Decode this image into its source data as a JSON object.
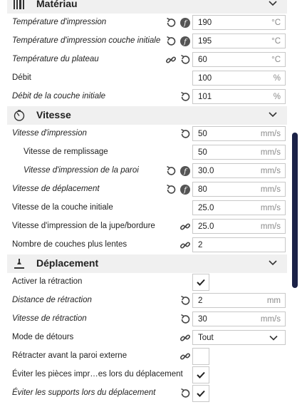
{
  "materiau": {
    "title": "Matériau",
    "rows": [
      {
        "label": "Température d'impression",
        "value": "190",
        "unit": "°C"
      },
      {
        "label": "Température d'impression couche initiale",
        "value": "195",
        "unit": "°C"
      },
      {
        "label": "Température du plateau",
        "value": "60",
        "unit": "°C"
      },
      {
        "label": "Débit",
        "value": "100",
        "unit": "%"
      },
      {
        "label": "Débit de la couche initiale",
        "value": "101",
        "unit": "%"
      }
    ]
  },
  "vitesse": {
    "title": "Vitesse",
    "rows": [
      {
        "label": "Vitesse d'impression",
        "value": "50",
        "unit": "mm/s"
      },
      {
        "label": "Vitesse de remplissage",
        "value": "50",
        "unit": "mm/s"
      },
      {
        "label": "Vitesse d'impression de la paroi",
        "value": "30.0",
        "unit": "mm/s"
      },
      {
        "label": "Vitesse de déplacement",
        "value": "80",
        "unit": "mm/s"
      },
      {
        "label": "Vitesse de la couche initiale",
        "value": "25.0",
        "unit": "mm/s"
      },
      {
        "label": "Vitesse d'impression de la jupe/bordure",
        "value": "25.0",
        "unit": "mm/s"
      },
      {
        "label": "Nombre de couches plus lentes",
        "value": "2",
        "unit": ""
      }
    ]
  },
  "deplacement": {
    "title": "Déplacement",
    "rows": [
      {
        "label": "Activer la rétraction"
      },
      {
        "label": "Distance de rétraction",
        "value": "2",
        "unit": "mm"
      },
      {
        "label": "Vitesse de rétraction",
        "value": "30",
        "unit": "mm/s"
      },
      {
        "label": "Mode de détours",
        "value": "Tout"
      },
      {
        "label": "Rétracter avant la paroi externe"
      },
      {
        "label": "Éviter les pièces impr…es lors du déplacement"
      },
      {
        "label": "Éviter les supports lors du déplacement"
      }
    ]
  },
  "icons": {
    "reset": "reset-icon",
    "function": "function-icon",
    "link": "link-icon",
    "check": "checkmark-icon",
    "chevron": "chevron-down-icon"
  }
}
